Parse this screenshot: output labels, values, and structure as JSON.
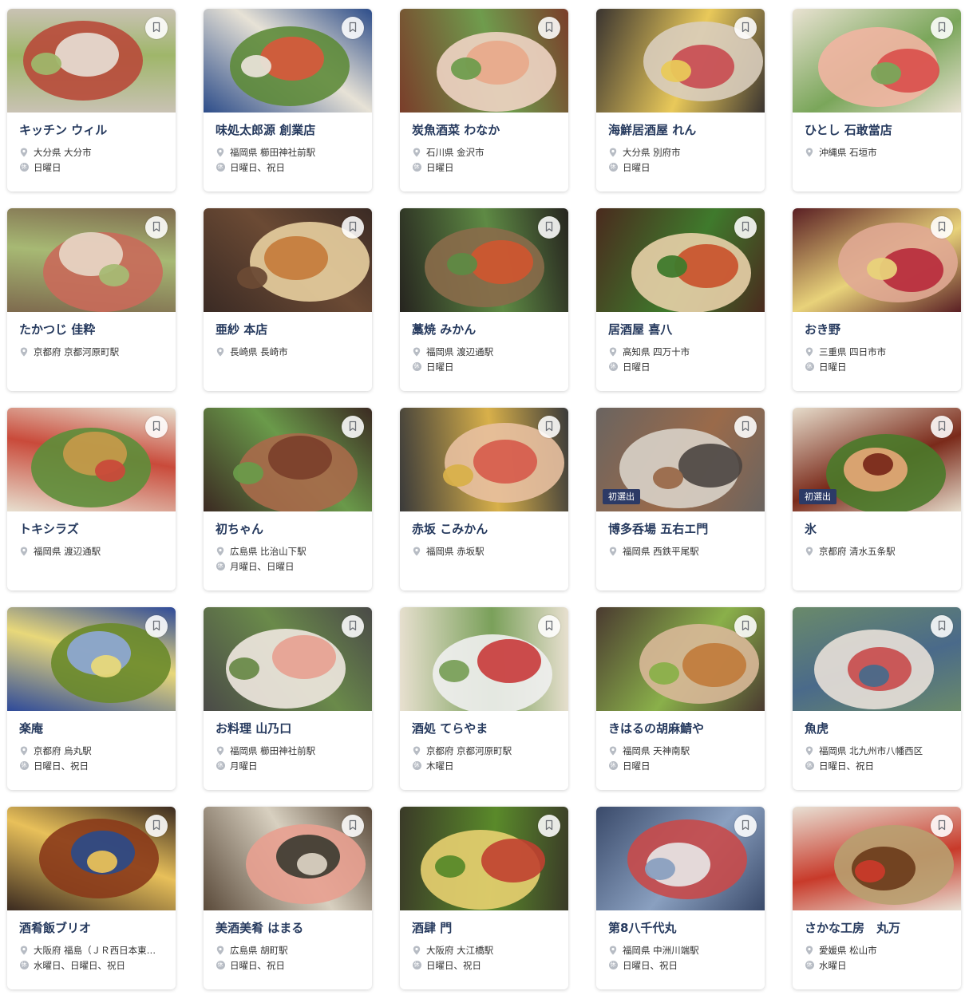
{
  "labels": {
    "closed_icon_glyph": "休"
  },
  "restaurants": [
    {
      "name": "キッチン ウィル",
      "location": "大分県 大分市",
      "closed": "日曜日",
      "badge": "",
      "colors": [
        "#c9c2b4",
        "#e8e0d6",
        "#b84a3a",
        "#9fb66a"
      ]
    },
    {
      "name": "味処太郎源 創業店",
      "location": "福岡県 櫛田神社前駅",
      "closed": "日曜日、祝日",
      "badge": "",
      "colors": [
        "#2d4d8a",
        "#d9583b",
        "#5e8b3a",
        "#e7e2d6"
      ]
    },
    {
      "name": "炭魚酒菜 わなか",
      "location": "石川県 金沢市",
      "closed": "日曜日",
      "badge": "",
      "colors": [
        "#7a3d2a",
        "#e8a98a",
        "#f0d4c4",
        "#6f9c4d"
      ]
    },
    {
      "name": "海鮮居酒屋 れん",
      "location": "大分県 別府市",
      "closed": "日曜日",
      "badge": "",
      "colors": [
        "#3a3430",
        "#c84a50",
        "#d9cdbd",
        "#e9c95a"
      ]
    },
    {
      "name": "ひとし 石敢當店",
      "location": "沖縄県 石垣市",
      "closed": "",
      "badge": "",
      "colors": [
        "#e9e2d2",
        "#d94e4a",
        "#f1b5a2",
        "#7aa65a"
      ]
    },
    {
      "name": "たかつじ 佳粋",
      "location": "京都府 京都河原町駅",
      "closed": "",
      "badge": "",
      "colors": [
        "#7e6a4e",
        "#e8d8c8",
        "#c96a5a",
        "#a7b974"
      ]
    },
    {
      "name": "亜紗 本店",
      "location": "長崎県 長崎市",
      "closed": "",
      "badge": "",
      "colors": [
        "#3a2a24",
        "#c47a38",
        "#e8cfa0",
        "#6b4a34"
      ]
    },
    {
      "name": "藁焼 みかん",
      "location": "福岡県 渡辺通駅",
      "closed": "日曜日",
      "badge": "",
      "colors": [
        "#26241f",
        "#d0552f",
        "#8a6b4a",
        "#5e8a44"
      ]
    },
    {
      "name": "居酒屋 喜八",
      "location": "高知県 四万十市",
      "closed": "日曜日",
      "badge": "",
      "colors": [
        "#4a2a1e",
        "#c9502a",
        "#e8d0a8",
        "#3f7a2c"
      ]
    },
    {
      "name": "おき野",
      "location": "三重県 四日市市",
      "closed": "日曜日",
      "badge": "",
      "colors": [
        "#5a1f24",
        "#b7293a",
        "#e0a894",
        "#e8d27a"
      ]
    },
    {
      "name": "トキシラズ",
      "location": "福岡県 渡辺通駅",
      "closed": "",
      "badge": "",
      "colors": [
        "#e7dfcf",
        "#c99a4a",
        "#5d8e3a",
        "#c94a3a"
      ]
    },
    {
      "name": "初ちゃん",
      "location": "広島県 比治山下駅",
      "closed": "月曜日、日曜日",
      "badge": "",
      "colors": [
        "#3b2a22",
        "#7a3e2a",
        "#a86a4a",
        "#6a9a4a"
      ]
    },
    {
      "name": "赤坂 こみかん",
      "location": "福岡県 赤坂駅",
      "closed": "",
      "badge": "",
      "colors": [
        "#3a3a3a",
        "#d65a4a",
        "#e8c0a0",
        "#d8b04a"
      ]
    },
    {
      "name": "博多呑場 五右エ門",
      "location": "福岡県 西鉄平尾駅",
      "closed": "",
      "badge": "初選出",
      "colors": [
        "#6a6460",
        "#4a4440",
        "#d8d2c8",
        "#9a6a4a"
      ]
    },
    {
      "name": "氷",
      "location": "京都府 清水五条駅",
      "closed": "",
      "badge": "初選出",
      "colors": [
        "#e6dccb",
        "#e8a878",
        "#4a7a2a",
        "#7a2a1a"
      ]
    },
    {
      "name": "楽庵",
      "location": "京都府 烏丸駅",
      "closed": "日曜日、祝日",
      "badge": "",
      "colors": [
        "#2e4a9a",
        "#8fa8d8",
        "#6a8a2a",
        "#e8d87a"
      ]
    },
    {
      "name": "お料理 山乃口",
      "location": "福岡県 櫛田神社前駅",
      "closed": "月曜日",
      "badge": "",
      "colors": [
        "#4a4a48",
        "#e8a090",
        "#f0e8e0",
        "#6a8a4a"
      ]
    },
    {
      "name": "酒処 てらやま",
      "location": "京都府 京都河原町駅",
      "closed": "木曜日",
      "badge": "",
      "colors": [
        "#e8e0d0",
        "#c83a3a",
        "#f0f0f0",
        "#7aa05a"
      ]
    },
    {
      "name": "きはるの胡麻鯖や",
      "location": "福岡県 天神南駅",
      "closed": "日曜日",
      "badge": "",
      "colors": [
        "#4a3a30",
        "#c07a3a",
        "#d8b898",
        "#8ab04a"
      ]
    },
    {
      "name": "魚虎",
      "location": "福岡県 北九州市八幡西区",
      "closed": "日曜日、祝日",
      "badge": "",
      "colors": [
        "#6a8a6a",
        "#c84a4a",
        "#e8e0d8",
        "#4a6a8a"
      ]
    },
    {
      "name": "酒肴飯ブリオ",
      "location": "大阪府 福島（ＪＲ西日本東西線）駅",
      "closed": "水曜日、日曜日、祝日",
      "badge": "",
      "colors": [
        "#3a2a20",
        "#2a4a8a",
        "#8a3a1a",
        "#e8c05a"
      ]
    },
    {
      "name": "美酒美肴 はまる",
      "location": "広島県 胡町駅",
      "closed": "日曜日、祝日",
      "badge": "",
      "colors": [
        "#5a4a3a",
        "#3a3a30",
        "#e8a090",
        "#d8d0c0"
      ]
    },
    {
      "name": "酒肆 門",
      "location": "大阪府 大江橋駅",
      "closed": "日曜日、祝日",
      "badge": "",
      "colors": [
        "#3a3a28",
        "#c04030",
        "#e8d070",
        "#5a8a2a"
      ]
    },
    {
      "name": "第8八千代丸",
      "location": "福岡県 中洲川端駅",
      "closed": "日曜日、祝日",
      "badge": "",
      "colors": [
        "#3a4a6a",
        "#e8e8e8",
        "#c84a4a",
        "#8aa0c0"
      ]
    },
    {
      "name": "さかな工房　丸万",
      "location": "愛媛県 松山市",
      "closed": "水曜日",
      "badge": "",
      "colors": [
        "#e8e0d4",
        "#6a3a1a",
        "#b8a070",
        "#c83a2a"
      ]
    }
  ]
}
